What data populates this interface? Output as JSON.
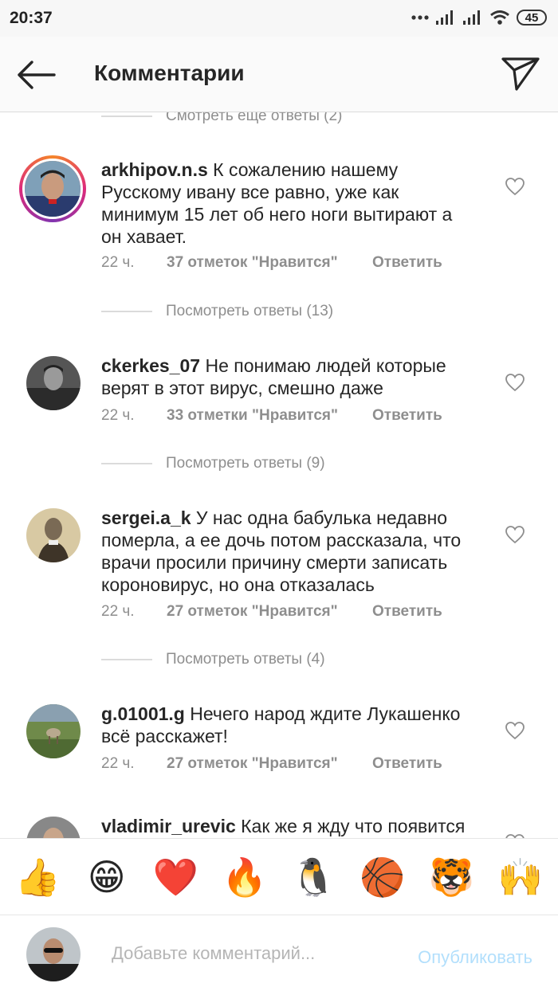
{
  "status": {
    "time": "20:37",
    "battery": "45"
  },
  "header": {
    "title": "Комментарии"
  },
  "top_replies": "Смотреть еще ответы (2)",
  "comments": [
    {
      "username": "arkhipov.n.s",
      "text": "К сожалению нашему Русскому ивану все равно, уже как минимум 15 лет об него ноги вытирают а он хавает.",
      "time": "22 ч.",
      "likes": "37 отметок \"Нравится\"",
      "reply": "Ответить",
      "view_replies": "Посмотреть ответы (13)"
    },
    {
      "username": "ckerkes_07",
      "text": "Не понимаю людей которые верят в этот вирус, смешно даже",
      "time": "22 ч.",
      "likes": "33 отметки \"Нравится\"",
      "reply": "Ответить",
      "view_replies": "Посмотреть ответы (9)"
    },
    {
      "username": "sergei.a_k",
      "text": "У нас одна бабулька недавно померла, а ее дочь потом рассказала, что врачи просили причину смерти записать короновирус, но она отказалась",
      "time": "22 ч.",
      "likes": "27 отметок \"Нравится\"",
      "reply": "Ответить",
      "view_replies": "Посмотреть ответы (4)"
    },
    {
      "username": "g.01001.g",
      "text": "Нечего народ ждите Лукашенко всё расскажет!",
      "time": "22 ч.",
      "likes": "27 отметок \"Нравится\"",
      "reply": "Ответить"
    },
    {
      "username": "vladimir_urevic",
      "text": "Как же я жду что появится"
    }
  ],
  "emoji_bar": {
    "items": [
      "👍",
      "😁",
      "❤️",
      "🔥",
      "🐧",
      "🏀",
      "🐯",
      "🙌"
    ]
  },
  "composer": {
    "placeholder": "Добавьте комментарий...",
    "publish": "Опубликовать"
  },
  "colors": {
    "muted": "#8e8e8e",
    "text": "#262626",
    "publish": "#b2dffc",
    "heart": "#8e8e8e"
  }
}
